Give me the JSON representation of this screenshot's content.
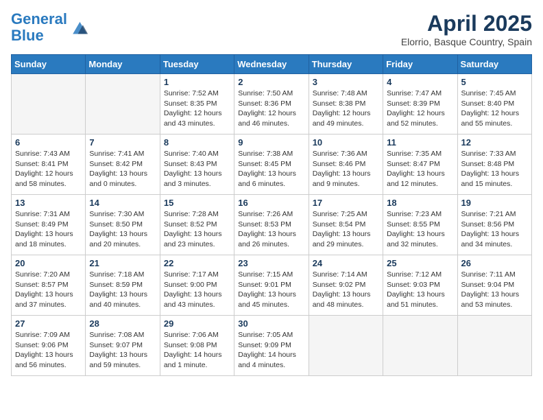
{
  "header": {
    "logo_line1": "General",
    "logo_line2": "Blue",
    "month_year": "April 2025",
    "location": "Elorrio, Basque Country, Spain"
  },
  "weekdays": [
    "Sunday",
    "Monday",
    "Tuesday",
    "Wednesday",
    "Thursday",
    "Friday",
    "Saturday"
  ],
  "weeks": [
    [
      {
        "day": "",
        "text": ""
      },
      {
        "day": "",
        "text": ""
      },
      {
        "day": "1",
        "text": "Sunrise: 7:52 AM\nSunset: 8:35 PM\nDaylight: 12 hours and 43 minutes."
      },
      {
        "day": "2",
        "text": "Sunrise: 7:50 AM\nSunset: 8:36 PM\nDaylight: 12 hours and 46 minutes."
      },
      {
        "day": "3",
        "text": "Sunrise: 7:48 AM\nSunset: 8:38 PM\nDaylight: 12 hours and 49 minutes."
      },
      {
        "day": "4",
        "text": "Sunrise: 7:47 AM\nSunset: 8:39 PM\nDaylight: 12 hours and 52 minutes."
      },
      {
        "day": "5",
        "text": "Sunrise: 7:45 AM\nSunset: 8:40 PM\nDaylight: 12 hours and 55 minutes."
      }
    ],
    [
      {
        "day": "6",
        "text": "Sunrise: 7:43 AM\nSunset: 8:41 PM\nDaylight: 12 hours and 58 minutes."
      },
      {
        "day": "7",
        "text": "Sunrise: 7:41 AM\nSunset: 8:42 PM\nDaylight: 13 hours and 0 minutes."
      },
      {
        "day": "8",
        "text": "Sunrise: 7:40 AM\nSunset: 8:43 PM\nDaylight: 13 hours and 3 minutes."
      },
      {
        "day": "9",
        "text": "Sunrise: 7:38 AM\nSunset: 8:45 PM\nDaylight: 13 hours and 6 minutes."
      },
      {
        "day": "10",
        "text": "Sunrise: 7:36 AM\nSunset: 8:46 PM\nDaylight: 13 hours and 9 minutes."
      },
      {
        "day": "11",
        "text": "Sunrise: 7:35 AM\nSunset: 8:47 PM\nDaylight: 13 hours and 12 minutes."
      },
      {
        "day": "12",
        "text": "Sunrise: 7:33 AM\nSunset: 8:48 PM\nDaylight: 13 hours and 15 minutes."
      }
    ],
    [
      {
        "day": "13",
        "text": "Sunrise: 7:31 AM\nSunset: 8:49 PM\nDaylight: 13 hours and 18 minutes."
      },
      {
        "day": "14",
        "text": "Sunrise: 7:30 AM\nSunset: 8:50 PM\nDaylight: 13 hours and 20 minutes."
      },
      {
        "day": "15",
        "text": "Sunrise: 7:28 AM\nSunset: 8:52 PM\nDaylight: 13 hours and 23 minutes."
      },
      {
        "day": "16",
        "text": "Sunrise: 7:26 AM\nSunset: 8:53 PM\nDaylight: 13 hours and 26 minutes."
      },
      {
        "day": "17",
        "text": "Sunrise: 7:25 AM\nSunset: 8:54 PM\nDaylight: 13 hours and 29 minutes."
      },
      {
        "day": "18",
        "text": "Sunrise: 7:23 AM\nSunset: 8:55 PM\nDaylight: 13 hours and 32 minutes."
      },
      {
        "day": "19",
        "text": "Sunrise: 7:21 AM\nSunset: 8:56 PM\nDaylight: 13 hours and 34 minutes."
      }
    ],
    [
      {
        "day": "20",
        "text": "Sunrise: 7:20 AM\nSunset: 8:57 PM\nDaylight: 13 hours and 37 minutes."
      },
      {
        "day": "21",
        "text": "Sunrise: 7:18 AM\nSunset: 8:59 PM\nDaylight: 13 hours and 40 minutes."
      },
      {
        "day": "22",
        "text": "Sunrise: 7:17 AM\nSunset: 9:00 PM\nDaylight: 13 hours and 43 minutes."
      },
      {
        "day": "23",
        "text": "Sunrise: 7:15 AM\nSunset: 9:01 PM\nDaylight: 13 hours and 45 minutes."
      },
      {
        "day": "24",
        "text": "Sunrise: 7:14 AM\nSunset: 9:02 PM\nDaylight: 13 hours and 48 minutes."
      },
      {
        "day": "25",
        "text": "Sunrise: 7:12 AM\nSunset: 9:03 PM\nDaylight: 13 hours and 51 minutes."
      },
      {
        "day": "26",
        "text": "Sunrise: 7:11 AM\nSunset: 9:04 PM\nDaylight: 13 hours and 53 minutes."
      }
    ],
    [
      {
        "day": "27",
        "text": "Sunrise: 7:09 AM\nSunset: 9:06 PM\nDaylight: 13 hours and 56 minutes."
      },
      {
        "day": "28",
        "text": "Sunrise: 7:08 AM\nSunset: 9:07 PM\nDaylight: 13 hours and 59 minutes."
      },
      {
        "day": "29",
        "text": "Sunrise: 7:06 AM\nSunset: 9:08 PM\nDaylight: 14 hours and 1 minute."
      },
      {
        "day": "30",
        "text": "Sunrise: 7:05 AM\nSunset: 9:09 PM\nDaylight: 14 hours and 4 minutes."
      },
      {
        "day": "",
        "text": ""
      },
      {
        "day": "",
        "text": ""
      },
      {
        "day": "",
        "text": ""
      }
    ]
  ]
}
